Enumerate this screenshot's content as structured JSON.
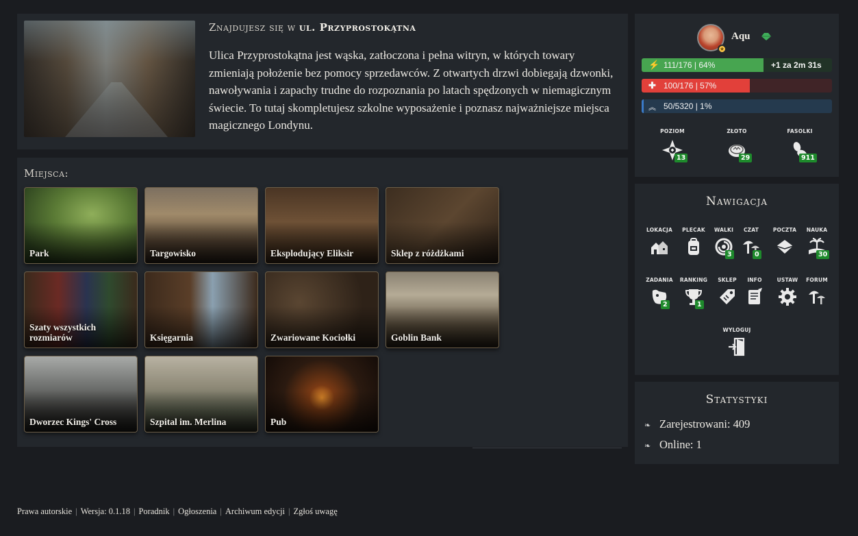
{
  "location": {
    "title_prefix": "Znajdujesz się w",
    "title_place": "ul. Przyprostokątna",
    "description": "Ulica Przyprostokątna jest wąska, zatłoczona i pełna witryn, w których towary zmieniają położenie bez pomocy sprzedawców. Z otwartych drzwi dobiegają dzwonki, nawoływania i zapachy trudne do rozpoznania po latach spędzonych w niemagicznym świecie. To tutaj skompletujesz szkolne wyposażenie i poznasz najważniejsze miejsca magicznego Londynu."
  },
  "places": {
    "title": "Miejsca:",
    "items": [
      {
        "label": "Park"
      },
      {
        "label": "Targowisko"
      },
      {
        "label": "Eksplodujący Eliksir"
      },
      {
        "label": "Sklep z różdżkami"
      },
      {
        "label": "Szaty wszystkich rozmiarów"
      },
      {
        "label": "Księgarnia"
      },
      {
        "label": "Zwariowane Kociołki"
      },
      {
        "label": "Goblin Bank"
      },
      {
        "label": "Dworzec Kings' Cross"
      },
      {
        "label": "Szpital im. Merlina"
      },
      {
        "label": "Pub"
      }
    ]
  },
  "profile": {
    "username": "Aqu",
    "energy": {
      "text": "111/176 | 64%",
      "fraction": 0.64,
      "regen": "+1 za 2m 31s",
      "color": "#47a550"
    },
    "health": {
      "text": "100/176 | 57%",
      "fraction": 0.57,
      "color": "#e2403a"
    },
    "experience": {
      "text": "50/5320 | 1%",
      "fraction": 0.01,
      "color": "#3a7ac8"
    },
    "stats": [
      {
        "label": "POZIOM",
        "value": "13",
        "icon": "level-icon"
      },
      {
        "label": "ZŁOTO",
        "value": "29",
        "icon": "gold-coins-icon"
      },
      {
        "label": "FASOLKI",
        "value": "911",
        "icon": "beans-icon"
      }
    ]
  },
  "navigation": {
    "title": "Nawigacja",
    "items": [
      {
        "label": "LOKACJA",
        "icon": "houses-icon",
        "badge": ""
      },
      {
        "label": "PLECAK",
        "icon": "backpack-icon",
        "badge": ""
      },
      {
        "label": "WALKI",
        "icon": "swirl-icon",
        "badge": "3"
      },
      {
        "label": "CZAT",
        "icon": "mushrooms-icon",
        "badge": "0"
      },
      {
        "label": "POCZTA",
        "icon": "envelope-icon",
        "badge": ""
      },
      {
        "label": "NAUKA",
        "icon": "book-palm-icon",
        "badge": "30"
      },
      {
        "label": "ZADANIA",
        "icon": "quest-icon",
        "badge": "2"
      },
      {
        "label": "RANKING",
        "icon": "trophy-icon",
        "badge": "1"
      },
      {
        "label": "SKLEP",
        "icon": "price-tag-icon",
        "badge": ""
      },
      {
        "label": "INFO",
        "icon": "scroll-icon",
        "badge": ""
      },
      {
        "label": "USTAW",
        "icon": "gear-icon",
        "badge": ""
      },
      {
        "label": "FORUM",
        "icon": "forum-icon",
        "badge": ""
      },
      {
        "label": "WYLOGUJ",
        "icon": "exit-door-icon",
        "badge": ""
      }
    ]
  },
  "statistics": {
    "title": "Statystyki",
    "registered": "Zarejestrowani: 409",
    "online": "Online: 1"
  },
  "footer": {
    "links": [
      "Prawa autorskie",
      "Wersja: 0.1.18",
      "Poradnik",
      "Ogłoszenia",
      "Archiwum edycji",
      "Zgłoś uwagę"
    ]
  }
}
